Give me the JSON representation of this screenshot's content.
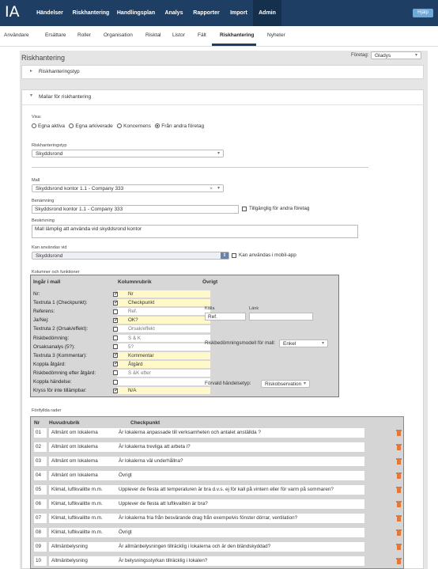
{
  "app": {
    "logo": "IA",
    "help": "Hjälp"
  },
  "nav": [
    "Händelser",
    "Riskhantering",
    "Handlingsplan",
    "Analys",
    "Rapporter",
    "Import",
    "Admin"
  ],
  "subnav": [
    "Användare",
    "Ersättare",
    "Roller",
    "Organisation",
    "Risktal",
    "Listor",
    "Fält",
    "Riskhantering",
    "Nyheter"
  ],
  "page": {
    "title": "Riskhantering",
    "foretag_label": "Företag:",
    "foretag_value": "Gladys"
  },
  "section1": {
    "title": "Riskhanteringstyp"
  },
  "section2": {
    "title": "Mallar för riskhantering"
  },
  "visa": {
    "label": "Visa:",
    "options": [
      "Egna aktiva",
      "Egna arkiverade",
      "Koncernens",
      "Från andra företag"
    ],
    "selected": "Från andra företag"
  },
  "riskhanteringstyp": {
    "label": "Riskhanteringstyp",
    "value": "Skyddsrond"
  },
  "mall": {
    "label": "Mall",
    "value": "Skyddsrond kontor 1.1 - Company 333"
  },
  "benamning": {
    "label": "Benämning",
    "value": "Skyddsrond kontor 1.1 - Company 333",
    "tillganglig": "Tillgänglig för andra företag"
  },
  "beskrivning": {
    "label": "Beskrivning",
    "value": "Mall lämplig att använda vid skyddsrond kontor"
  },
  "kan_anvandas": {
    "label": "Kan användas vid",
    "value": "Skyddsrond",
    "mobil": "Kan användas i mobil-app"
  },
  "kolumner": {
    "label": "Kolumner och funktioner",
    "h1": "Ingår i mall",
    "h2": "Kolumnrubrik",
    "h3": "Övrigt",
    "rows": [
      {
        "label": "Nr:",
        "checked": true,
        "value": "Nr",
        "style": "y"
      },
      {
        "label": "Textruta 1 (Checkpunkt):",
        "checked": true,
        "value": "Checkpunkt",
        "style": "y"
      },
      {
        "label": "Referens:",
        "checked": false,
        "value": "Ref.",
        "style": "w"
      },
      {
        "label": "Ja/Nej:",
        "checked": true,
        "value": "OK?",
        "style": "y"
      },
      {
        "label": "Textruta 2 (Orsak/effekt):",
        "checked": false,
        "value": "Orsak/effekt",
        "style": "w"
      },
      {
        "label": "Riskbedömning:",
        "checked": false,
        "value": "S & K",
        "style": "w"
      },
      {
        "label": "Orsaksanalys (5?):",
        "checked": false,
        "value": "5?",
        "style": "w"
      },
      {
        "label": "Textruta 3 (Kommentar):",
        "checked": true,
        "value": "Kommentar",
        "style": "y"
      },
      {
        "label": "Koppla åtgärd:",
        "checked": true,
        "value": "Åtgärd",
        "style": "y"
      },
      {
        "label": "Riskbedömning efter åtgärd:",
        "checked": false,
        "value": "S &K efter",
        "style": "w"
      },
      {
        "label": "Koppla händelse:",
        "checked": false,
        "value": "",
        "style": "w"
      },
      {
        "label": "Kryss för inte tillämpbar:",
        "checked": true,
        "value": "N/A",
        "style": "y"
      }
    ],
    "kalla_label": "Källa",
    "kalla_value": "Ref.",
    "lank_label": "Länk",
    "lank_value": "",
    "riskmodell_label": "Riskbedömningsmodell för mall:",
    "riskmodell_value": "Enkel",
    "forvald_label": "Förvald händelsetyp:",
    "forvald_value": "Riskobservation"
  },
  "forifyllda": {
    "label": "Förifyllda rader",
    "h_nr": "Nr",
    "h_huvud": "Huvudrubrik",
    "h_check": "Checkpunkt",
    "rows": [
      {
        "nr": "01",
        "huvud": "Allmänt om lokalerna",
        "check": "Är lokalerna anpassade till verksamheten och antalet anställda ?"
      },
      {
        "nr": "02",
        "huvud": "Allmänt om lokalerna",
        "check": "Är lokalerna trevliga att arbeta i?"
      },
      {
        "nr": "03",
        "huvud": "Allmänt om lokalerna",
        "check": "Är lokalerna väl underhållna?"
      },
      {
        "nr": "04",
        "huvud": "Allmänt om lokalerna",
        "check": "Övrigt"
      },
      {
        "nr": "05",
        "huvud": "Klimat, luftkvalitte m.m.",
        "check": "Upplever de flesta att temperaturen är bra d.v.s. ej för kall på vintern eller för varm på sommaren?"
      },
      {
        "nr": "06",
        "huvud": "Klimat, luftkvalitte m.m.",
        "check": "Upplever de flesta att luftkvalitén är bra?"
      },
      {
        "nr": "07",
        "huvud": "Klimat, luftkvalitte m.m.",
        "check": "Är lokalerna fria från besvärande drag från exempelvis fönster dörrar, ventilation?"
      },
      {
        "nr": "08",
        "huvud": "Klimat, luftkvalitte m.m.",
        "check": "Övrigt"
      },
      {
        "nr": "09",
        "huvud": "Allmänbelysning",
        "check": "Är allmänbelysningen tillräcklig i lokalerna och är den bländskyddad?"
      },
      {
        "nr": "10",
        "huvud": "Allmänbelysning",
        "check": "Är belysningsstyrkan tillräcklig i lokalen?"
      }
    ]
  }
}
